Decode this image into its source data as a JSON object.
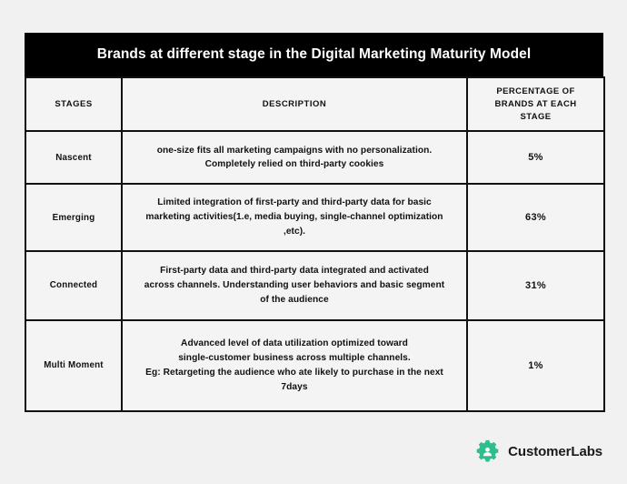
{
  "table": {
    "title": "Brands at different stage in the Digital Marketing Maturity Model",
    "headers": {
      "stages": "STAGES",
      "description": "DESCRIPTION",
      "percentage": "PERCENTAGE OF BRANDS AT EACH STAGE"
    },
    "rows": [
      {
        "stage": "Nascent",
        "description_lines": [
          "one-size fits all marketing campaigns with no personalization.",
          "Completely relied on third-party cookies"
        ],
        "percentage": "5%"
      },
      {
        "stage": "Emerging",
        "description_lines": [
          "Limited integration of first-party and third-party data for basic",
          "marketing activities(1.e, media buying, single-channel optimization ,etc)."
        ],
        "percentage": "63%"
      },
      {
        "stage": "Connected",
        "description_lines": [
          "First-party data and third-party data integrated and activated",
          "across channels. Understanding user behaviors and basic segment",
          "of the audience"
        ],
        "percentage": "31%"
      },
      {
        "stage": "Multi Moment",
        "description_lines": [
          "Advanced level of data utilization optimized toward",
          "single-customer business across multiple channels.",
          "Eg: Retargeting the audience who ate likely to purchase in the next 7days"
        ],
        "percentage": "1%"
      }
    ]
  },
  "branding": {
    "name": "CustomerLabs",
    "logo_icon": "gear-user-icon",
    "logo_color": "#2DBE8C",
    "text_color": "#1a1a1a"
  },
  "theme": {
    "page_background": "#f1f1f1",
    "table_background": "#f4f4f4",
    "title_background": "#000000",
    "title_color": "#ffffff",
    "border_color": "#111111"
  },
  "chart_data": {
    "type": "table",
    "title": "Brands at different stage in the Digital Marketing Maturity Model",
    "columns": [
      "STAGES",
      "DESCRIPTION",
      "PERCENTAGE OF BRANDS AT EACH STAGE"
    ],
    "categories": [
      "Nascent",
      "Emerging",
      "Connected",
      "Multi Moment"
    ],
    "values": [
      5,
      63,
      31,
      1
    ],
    "value_labels": [
      "5%",
      "63%",
      "31%",
      "1%"
    ],
    "ylabel": "Percentage of brands at each stage",
    "units": "percent"
  }
}
